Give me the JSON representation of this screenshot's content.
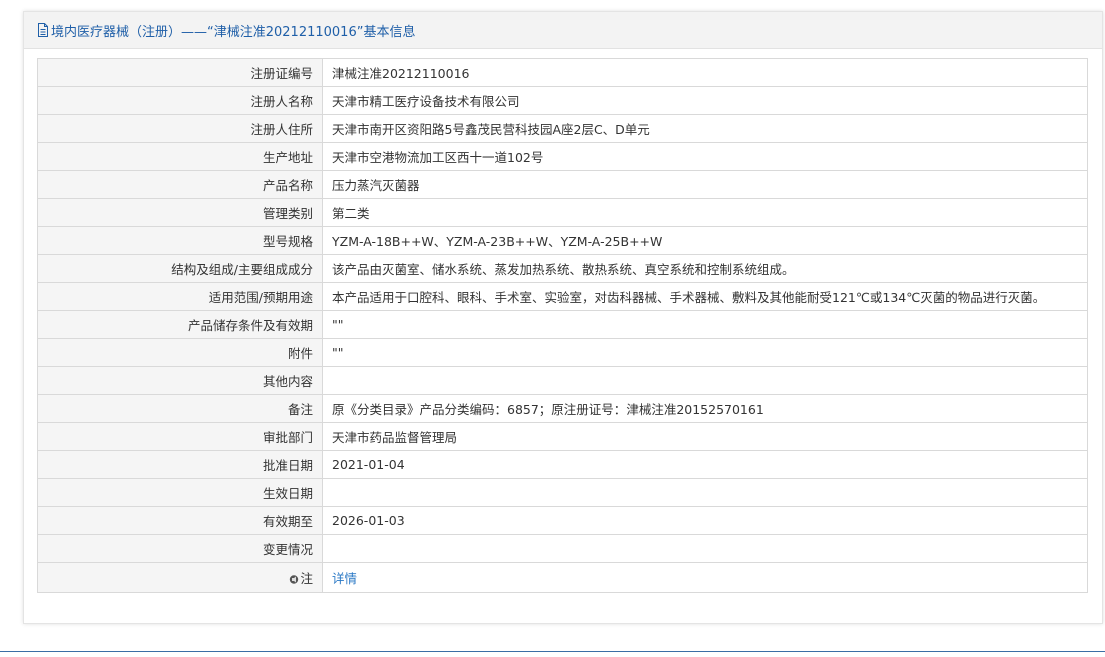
{
  "panel": {
    "title": "境内医疗器械（注册）——“津械注准20212110016”基本信息"
  },
  "rows": [
    {
      "label": "注册证编号",
      "value": "津械注准20212110016"
    },
    {
      "label": "注册人名称",
      "value": "天津市精工医疗设备技术有限公司"
    },
    {
      "label": "注册人住所",
      "value": "天津市南开区资阳路5号鑫茂民营科技园A座2层C、D单元"
    },
    {
      "label": "生产地址",
      "value": "天津市空港物流加工区西十一道102号"
    },
    {
      "label": "产品名称",
      "value": "压力蒸汽灭菌器"
    },
    {
      "label": "管理类别",
      "value": "第二类"
    },
    {
      "label": "型号规格",
      "value": "YZM-A-18B++W、YZM-A-23B++W、YZM-A-25B++W"
    },
    {
      "label": "结构及组成/主要组成成分",
      "value": "该产品由灭菌室、储水系统、蒸发加热系统、散热系统、真空系统和控制系统组成。"
    },
    {
      "label": "适用范围/预期用途",
      "value": "本产品适用于口腔科、眼科、手术室、实验室，对齿科器械、手术器械、敷料及其他能耐受121℃或134℃灭菌的物品进行灭菌。"
    },
    {
      "label": "产品储存条件及有效期",
      "value": "\"\""
    },
    {
      "label": "附件",
      "value": "\"\""
    },
    {
      "label": "其他内容",
      "value": ""
    },
    {
      "label": "备注",
      "value": "原《分类目录》产品分类编码：6857；原注册证号：津械注准20152570161"
    },
    {
      "label": "审批部门",
      "value": "天津市药品监督管理局"
    },
    {
      "label": "批准日期",
      "value": "2021-01-04"
    },
    {
      "label": "生效日期",
      "value": ""
    },
    {
      "label": "有效期至",
      "value": "2026-01-03"
    },
    {
      "label": "变更情况",
      "value": ""
    }
  ],
  "note_row": {
    "label": "注",
    "link": "详情"
  },
  "icons": {
    "header": "document-icon",
    "note": "speaker-icon"
  }
}
